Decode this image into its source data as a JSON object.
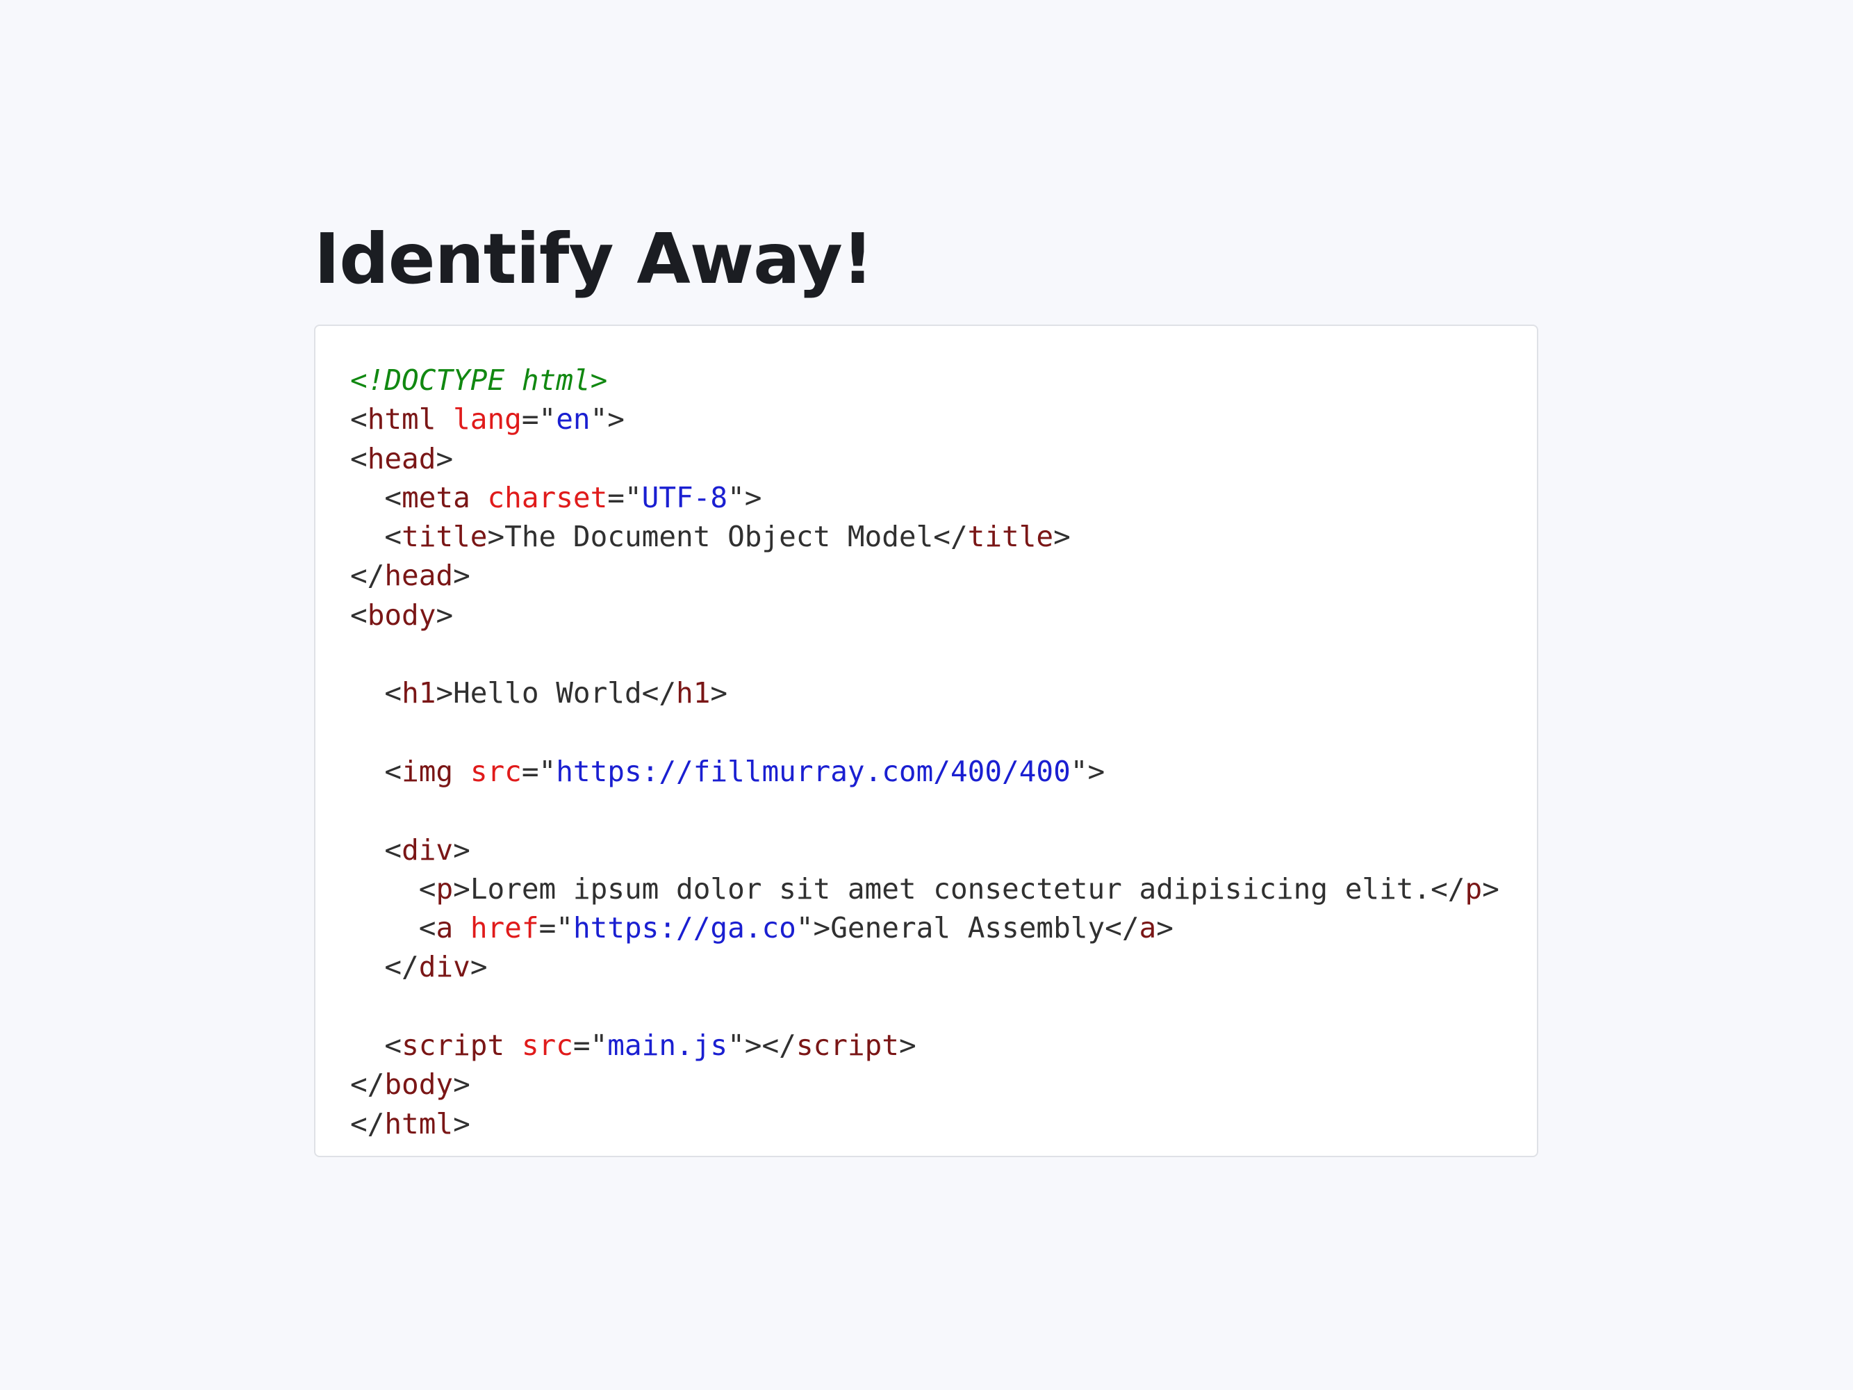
{
  "title": "Identify Away!",
  "colors": {
    "background": "#f7f8fc",
    "panel": "#ffffff",
    "doctype": "#118811",
    "tag": "#7a1616",
    "attribute": "#e01b1b",
    "string": "#1a1fd1",
    "text": "#303030"
  },
  "code_lines": [
    [
      {
        "t": "doctype",
        "v": "<!DOCTYPE html>"
      }
    ],
    [
      {
        "t": "punct",
        "v": "<"
      },
      {
        "t": "tag",
        "v": "html"
      },
      {
        "t": "text",
        "v": " "
      },
      {
        "t": "attr",
        "v": "lang"
      },
      {
        "t": "punct",
        "v": "=\""
      },
      {
        "t": "str",
        "v": "en"
      },
      {
        "t": "punct",
        "v": "\">"
      }
    ],
    [
      {
        "t": "punct",
        "v": "<"
      },
      {
        "t": "tag",
        "v": "head"
      },
      {
        "t": "punct",
        "v": ">"
      }
    ],
    [
      {
        "t": "text",
        "v": "  "
      },
      {
        "t": "punct",
        "v": "<"
      },
      {
        "t": "tag",
        "v": "meta"
      },
      {
        "t": "text",
        "v": " "
      },
      {
        "t": "attr",
        "v": "charset"
      },
      {
        "t": "punct",
        "v": "=\""
      },
      {
        "t": "str",
        "v": "UTF-8"
      },
      {
        "t": "punct",
        "v": "\">"
      }
    ],
    [
      {
        "t": "text",
        "v": "  "
      },
      {
        "t": "punct",
        "v": "<"
      },
      {
        "t": "tag",
        "v": "title"
      },
      {
        "t": "punct",
        "v": ">"
      },
      {
        "t": "text",
        "v": "The Document Object Model"
      },
      {
        "t": "punct",
        "v": "</"
      },
      {
        "t": "tag",
        "v": "title"
      },
      {
        "t": "punct",
        "v": ">"
      }
    ],
    [
      {
        "t": "punct",
        "v": "</"
      },
      {
        "t": "tag",
        "v": "head"
      },
      {
        "t": "punct",
        "v": ">"
      }
    ],
    [
      {
        "t": "punct",
        "v": "<"
      },
      {
        "t": "tag",
        "v": "body"
      },
      {
        "t": "punct",
        "v": ">"
      }
    ],
    [],
    [
      {
        "t": "text",
        "v": "  "
      },
      {
        "t": "punct",
        "v": "<"
      },
      {
        "t": "tag",
        "v": "h1"
      },
      {
        "t": "punct",
        "v": ">"
      },
      {
        "t": "text",
        "v": "Hello World"
      },
      {
        "t": "punct",
        "v": "</"
      },
      {
        "t": "tag",
        "v": "h1"
      },
      {
        "t": "punct",
        "v": ">"
      }
    ],
    [],
    [
      {
        "t": "text",
        "v": "  "
      },
      {
        "t": "punct",
        "v": "<"
      },
      {
        "t": "tag",
        "v": "img"
      },
      {
        "t": "text",
        "v": " "
      },
      {
        "t": "attr",
        "v": "src"
      },
      {
        "t": "punct",
        "v": "=\""
      },
      {
        "t": "str",
        "v": "https://fillmurray.com/400/400"
      },
      {
        "t": "punct",
        "v": "\">"
      }
    ],
    [],
    [
      {
        "t": "text",
        "v": "  "
      },
      {
        "t": "punct",
        "v": "<"
      },
      {
        "t": "tag",
        "v": "div"
      },
      {
        "t": "punct",
        "v": ">"
      }
    ],
    [
      {
        "t": "text",
        "v": "    "
      },
      {
        "t": "punct",
        "v": "<"
      },
      {
        "t": "tag",
        "v": "p"
      },
      {
        "t": "punct",
        "v": ">"
      },
      {
        "t": "text",
        "v": "Lorem ipsum dolor sit amet consectetur adipisicing elit."
      },
      {
        "t": "punct",
        "v": "</"
      },
      {
        "t": "tag",
        "v": "p"
      },
      {
        "t": "punct",
        "v": ">"
      }
    ],
    [
      {
        "t": "text",
        "v": "    "
      },
      {
        "t": "punct",
        "v": "<"
      },
      {
        "t": "tag",
        "v": "a"
      },
      {
        "t": "text",
        "v": " "
      },
      {
        "t": "attr",
        "v": "href"
      },
      {
        "t": "punct",
        "v": "=\""
      },
      {
        "t": "str",
        "v": "https://ga.co"
      },
      {
        "t": "punct",
        "v": "\">"
      },
      {
        "t": "text",
        "v": "General Assembly"
      },
      {
        "t": "punct",
        "v": "</"
      },
      {
        "t": "tag",
        "v": "a"
      },
      {
        "t": "punct",
        "v": ">"
      }
    ],
    [
      {
        "t": "text",
        "v": "  "
      },
      {
        "t": "punct",
        "v": "</"
      },
      {
        "t": "tag",
        "v": "div"
      },
      {
        "t": "punct",
        "v": ">"
      }
    ],
    [],
    [
      {
        "t": "text",
        "v": "  "
      },
      {
        "t": "punct",
        "v": "<"
      },
      {
        "t": "tag",
        "v": "script"
      },
      {
        "t": "text",
        "v": " "
      },
      {
        "t": "attr",
        "v": "src"
      },
      {
        "t": "punct",
        "v": "=\""
      },
      {
        "t": "str",
        "v": "main.js"
      },
      {
        "t": "punct",
        "v": "\"></"
      },
      {
        "t": "tag",
        "v": "script"
      },
      {
        "t": "punct",
        "v": ">"
      }
    ],
    [
      {
        "t": "punct",
        "v": "</"
      },
      {
        "t": "tag",
        "v": "body"
      },
      {
        "t": "punct",
        "v": ">"
      }
    ],
    [
      {
        "t": "punct",
        "v": "</"
      },
      {
        "t": "tag",
        "v": "html"
      },
      {
        "t": "punct",
        "v": ">"
      }
    ]
  ]
}
